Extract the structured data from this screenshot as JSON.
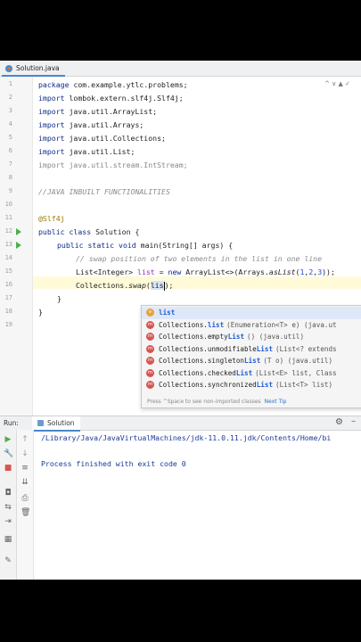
{
  "editor_tab": {
    "label": "Solution.java"
  },
  "editor_hint": "^ ∨ ▲ ✓",
  "line_numbers": [
    "1",
    "2",
    "3",
    "4",
    "5",
    "6",
    "7",
    "8",
    "9",
    "10",
    "11",
    "12",
    "13",
    "14",
    "15",
    "16",
    "17",
    "18",
    "19"
  ],
  "code": {
    "l1": {
      "kw": "package",
      "rest": " com.example.ytlc.problems;"
    },
    "l2": {
      "kw": "import",
      "rest": " lombok.extern.slf4j.Slf4j;"
    },
    "l3": {
      "kw": "import",
      "rest": " java.util.ArrayList;"
    },
    "l4": {
      "kw": "import",
      "rest": " java.util.Arrays;"
    },
    "l5": {
      "kw": "import",
      "rest": " java.util.Collections;"
    },
    "l6": {
      "kw": "import",
      "rest": " java.util.List;"
    },
    "l7": {
      "kw": "import",
      "rest": " java.util.stream.IntStream;"
    },
    "l9": "//JAVA INBUILT FUNCTIONALITIES",
    "l11": "@Slf4j",
    "l12": {
      "kw": "public class",
      "rest": " Solution {"
    },
    "l13": {
      "kw": "public static void",
      "rest": " main(String[] args) {"
    },
    "l14": "// swap position of two elements in the list in one line",
    "l15": {
      "a": "List<Integer> ",
      "var": "list",
      "b": " = ",
      "kw": "new",
      "c": " ArrayList<>(Arrays.",
      "m": "asList",
      "d": "(",
      "n1": "1",
      ",1": ",",
      "n2": "2",
      ",2": ",",
      "n3": "3",
      "e": "));"
    },
    "l16": {
      "a": "Collections.",
      "m": "swap",
      "b": "(",
      "typed": "lis",
      "c": ");"
    },
    "l17": "}",
    "l18": "}"
  },
  "completion": {
    "items": [
      {
        "icon": "v",
        "match": "list",
        "rest": "",
        "sig": ""
      },
      {
        "icon": "m",
        "pre": "Collections.",
        "match": "list",
        "rest": "",
        "sig": "(Enumeration<T> e) (java.ut"
      },
      {
        "icon": "m",
        "pre": "Collections.empty",
        "match": "List",
        "rest": "",
        "sig": "() (java.util)"
      },
      {
        "icon": "m",
        "pre": "Collections.unmodifiable",
        "match": "List",
        "rest": "",
        "sig": "(List<? extends"
      },
      {
        "icon": "m",
        "pre": "Collections.singleton",
        "match": "List",
        "rest": "",
        "sig": "(T o) (java.util)"
      },
      {
        "icon": "m",
        "pre": "Collections.checked",
        "match": "List",
        "rest": "",
        "sig": "(List<E> list, Class"
      },
      {
        "icon": "m",
        "pre": "Collections.synchronized",
        "match": "List",
        "rest": "",
        "sig": "(List<T> list)"
      }
    ],
    "footer": "Press ^Space to see non-imported classes",
    "next_tip": "Next Tip"
  },
  "run_panel": {
    "label": "Run:",
    "tab": "Solution",
    "path": "/Library/Java/JavaVirtualMachines/jdk-11.0.11.jdk/Contents/Home/bi",
    "exit": "Process finished with exit code 0"
  },
  "colors": {
    "keyword": "#0d2b8a",
    "comment": "#8c8c8c",
    "accent": "#4a86c8",
    "run": "#4caf50"
  }
}
